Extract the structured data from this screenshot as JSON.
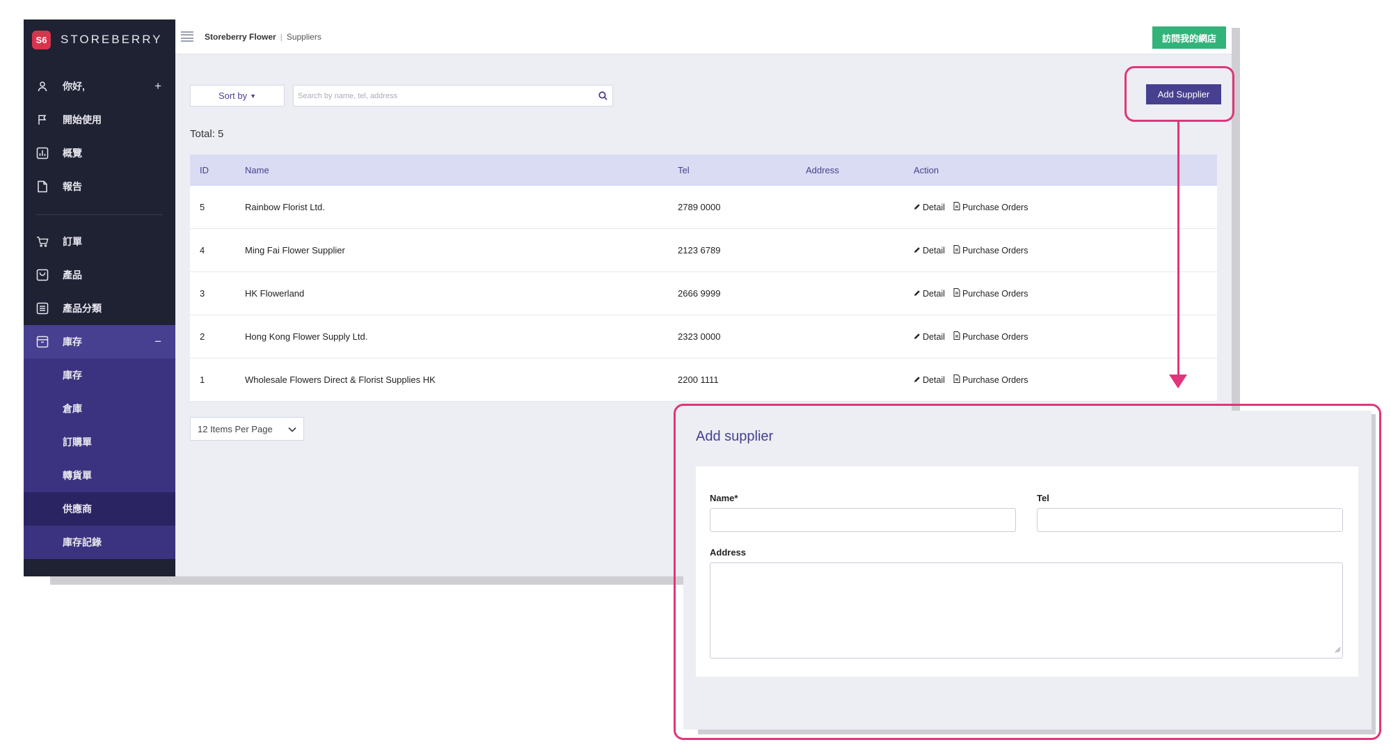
{
  "brand": {
    "name": "STOREBERRY",
    "mark": "S6"
  },
  "sidebar": {
    "items": [
      {
        "label": "你好,",
        "icon": "user-icon",
        "right": "+"
      },
      {
        "label": "開始使用",
        "icon": "flag-icon"
      },
      {
        "label": "概覽",
        "icon": "chart-icon"
      },
      {
        "label": "報告",
        "icon": "document-icon"
      }
    ],
    "items2": [
      {
        "label": "訂單",
        "icon": "cart-icon"
      },
      {
        "label": "產品",
        "icon": "bag-icon"
      },
      {
        "label": "產品分類",
        "icon": "list-icon"
      },
      {
        "label": "庫存",
        "icon": "inventory-icon",
        "right": "−"
      }
    ],
    "subitems": [
      "庫存",
      "倉庫",
      "訂購單",
      "轉貨單",
      "供應商",
      "庫存記錄"
    ]
  },
  "topbar": {
    "shop": "Storeberry Flower",
    "separator": "|",
    "page": "Suppliers",
    "visit_label": "訪問我的網店"
  },
  "toolbar": {
    "sort_label": "Sort by",
    "search_placeholder": "Search by name, tel, address",
    "add_label": "Add Supplier"
  },
  "total_text": "Total: 5",
  "table": {
    "headers": [
      "ID",
      "Name",
      "Tel",
      "Address",
      "Action"
    ],
    "rows": [
      {
        "id": "5",
        "name": "Rainbow Florist Ltd.",
        "tel": "2789 0000",
        "address": ""
      },
      {
        "id": "4",
        "name": "Ming Fai Flower Supplier",
        "tel": "2123 6789",
        "address": ""
      },
      {
        "id": "3",
        "name": "HK Flowerland",
        "tel": "2666 9999",
        "address": ""
      },
      {
        "id": "2",
        "name": "Hong Kong Flower Supply Ltd.",
        "tel": "2323 0000",
        "address": ""
      },
      {
        "id": "1",
        "name": "Wholesale Flowers Direct & Florist Supplies HK",
        "tel": "2200 1111",
        "address": ""
      }
    ],
    "detail_label": "Detail",
    "po_label": "Purchase Orders"
  },
  "pagination": {
    "per_page": "12 Items Per Page"
  },
  "modal": {
    "title": "Add supplier",
    "name_label": "Name*",
    "tel_label": "Tel",
    "address_label": "Address"
  },
  "colors": {
    "accent": "#473f8f",
    "highlight": "#e0357a",
    "visit": "#31b37a",
    "sidebar": "#1f2233"
  }
}
